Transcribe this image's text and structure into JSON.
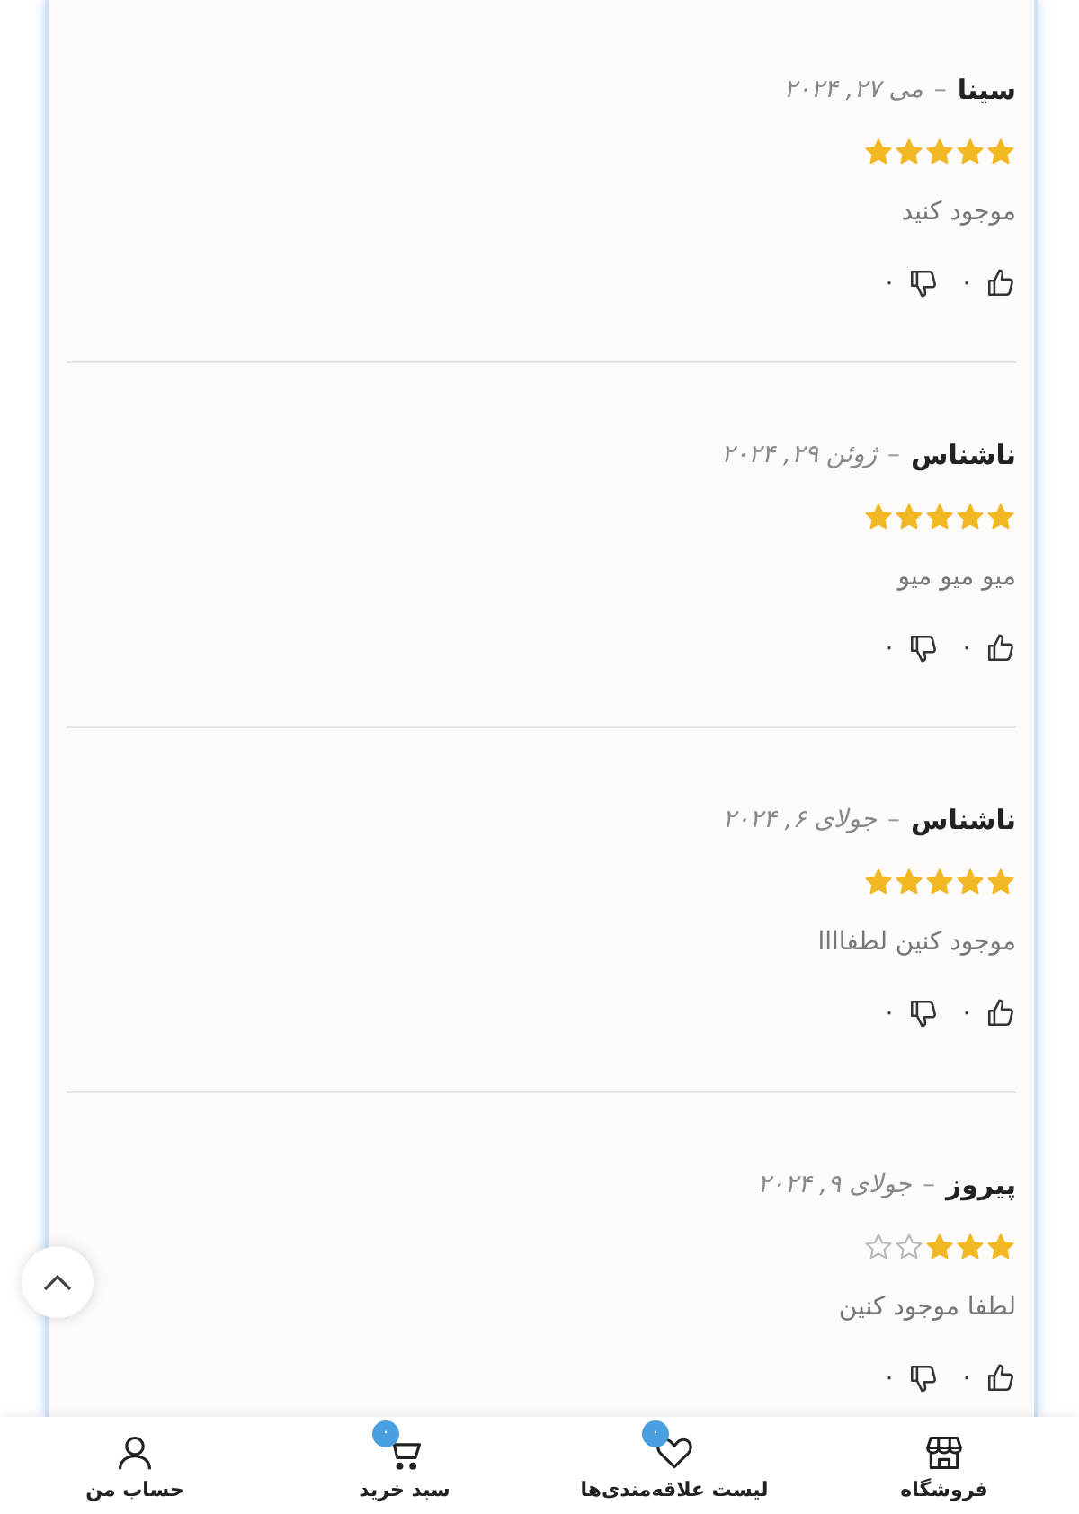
{
  "reviews": [
    {
      "author": "سینا",
      "separator": "–",
      "date": "می ۲۷, ۲۰۲۴",
      "stars": 5,
      "text": "موجود کنید",
      "likes": "۰",
      "dislikes": "۰"
    },
    {
      "author": "ناشناس",
      "separator": "–",
      "date": "ژوئن ۲۹, ۲۰۲۴",
      "stars": 5,
      "text": "میو میو میو",
      "likes": "۰",
      "dislikes": "۰"
    },
    {
      "author": "ناشناس",
      "separator": "–",
      "date": "جولای ۶, ۲۰۲۴",
      "stars": 5,
      "text": "موجود کنین لطفاااا",
      "likes": "۰",
      "dislikes": "۰"
    },
    {
      "author": "پیروز",
      "separator": "–",
      "date": "جولای ۹, ۲۰۲۴",
      "stars": 3,
      "text": "لطفا موجود کنین",
      "likes": "۰",
      "dislikes": "۰"
    }
  ],
  "nav": [
    {
      "kind": "shop",
      "label": "فروشگاه"
    },
    {
      "kind": "wishlist",
      "label": "لیست علاقه‌مندی‌ها",
      "badge": "۰"
    },
    {
      "kind": "cart",
      "label": "سبد خرید",
      "badge": "۰"
    },
    {
      "kind": "account",
      "label": "حساب من"
    }
  ]
}
